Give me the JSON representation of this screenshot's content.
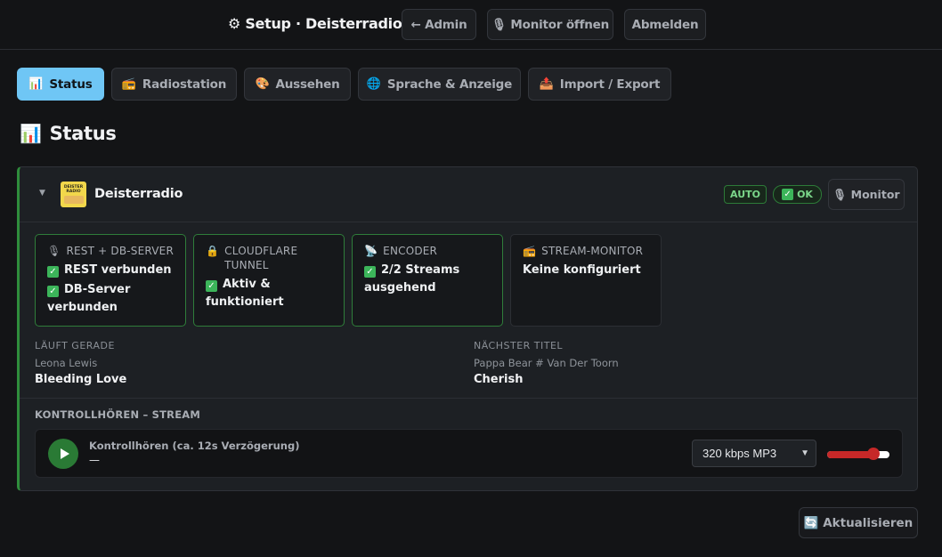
{
  "header": {
    "title": "⚙ Setup · Deisterradio",
    "buttons": {
      "admin": "← Admin",
      "monitor": "🎙 Monitor öffnen",
      "logout": "Abmelden"
    }
  },
  "tabs": [
    {
      "icon": "📊",
      "label": "Status",
      "active": true
    },
    {
      "icon": "📻",
      "label": "Radiostation"
    },
    {
      "icon": "🎨",
      "label": "Aussehen"
    },
    {
      "icon": "🌐",
      "label": "Sprache & Anzeige"
    },
    {
      "icon": "📤",
      "label": "Import / Export"
    }
  ],
  "section": {
    "icon": "📊",
    "title": "Status"
  },
  "station": {
    "name": "Deisterradio",
    "logo_text": "DEISTER RADIO",
    "badge_auto": "AUTO",
    "badge_ok": "OK",
    "monitor_button": "🎙 Monitor",
    "cards": [
      {
        "icon": "🎙",
        "title": "REST + DB-SERVER",
        "lines": [
          "REST verbunden",
          "DB-Server verbunden"
        ],
        "checked": true
      },
      {
        "icon": "🔒",
        "title": "CLOUDFLARE TUNNEL",
        "lines": [
          "Aktiv & funktioniert"
        ],
        "checked": true
      },
      {
        "icon": "📡",
        "title": "ENCODER",
        "lines": [
          "2/2 Streams ausgehend"
        ],
        "checked": true
      },
      {
        "icon": "📻",
        "title": "STREAM-MONITOR",
        "lines": [
          "Keine konfiguriert"
        ],
        "checked": false
      }
    ],
    "now_playing": {
      "label": "LÄUFT GERADE",
      "artist": "Leona Lewis",
      "title": "Bleeding Love"
    },
    "next": {
      "label": "NÄCHSTER TITEL",
      "artist": "Pappa Bear # Van Der Toorn",
      "title": "Cherish"
    },
    "monitor": {
      "label": "KONTROLLHÖREN – STREAM",
      "player_title": "Kontrollhören (ca. 12s Verzögerung)",
      "player_status": "—",
      "quality": "320 kbps MP3",
      "volume": 0.8
    }
  },
  "refresh_button": "🔄 Aktualisieren",
  "colors": {
    "accent": "#6fc6f5",
    "ok": "#2f8d3c",
    "slider": "#c62828"
  }
}
